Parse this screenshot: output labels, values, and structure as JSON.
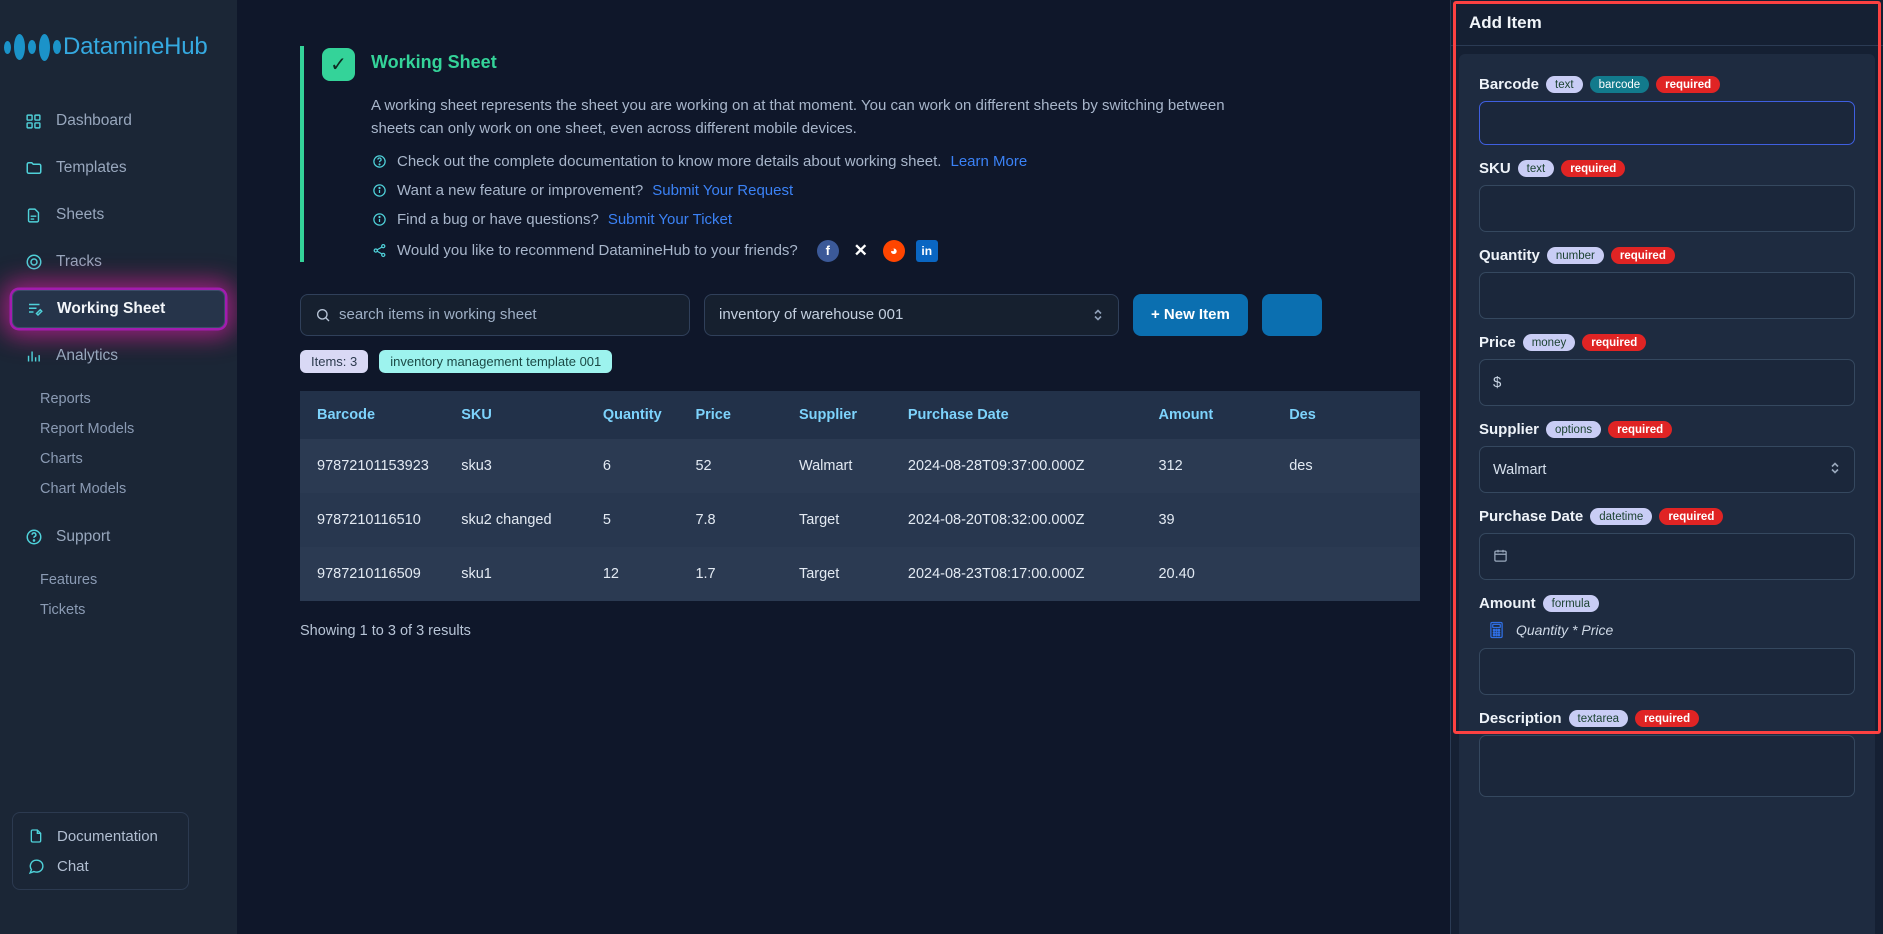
{
  "brand": {
    "name": "DatamineHub",
    "logo_icon": "bars-logo-icon"
  },
  "sidebar": {
    "items": [
      {
        "label": "Dashboard",
        "icon": "grid-icon"
      },
      {
        "label": "Templates",
        "icon": "folder-icon"
      },
      {
        "label": "Sheets",
        "icon": "document-icon"
      },
      {
        "label": "Tracks",
        "icon": "target-icon"
      },
      {
        "label": "Working Sheet",
        "icon": "sheet-edit-icon",
        "active": true
      },
      {
        "label": "Analytics",
        "icon": "bar-chart-icon"
      }
    ],
    "analytics_sub": [
      "Reports",
      "Report Models",
      "Charts",
      "Chart Models"
    ],
    "support": {
      "label": "Support",
      "icon": "question-circle-icon"
    },
    "support_sub": [
      "Features",
      "Tickets"
    ],
    "bottom": [
      {
        "label": "Documentation",
        "icon": "file-icon"
      },
      {
        "label": "Chat",
        "icon": "chat-bubble-icon"
      }
    ]
  },
  "notice": {
    "title": "Working Sheet",
    "body": "A working sheet represents the sheet you are working on at that moment. You can work on different sheets by switching between sheets can only work on one sheet, even across different mobile devices.",
    "doc_text": "Check out the complete documentation to know more details about working sheet.",
    "doc_link": "Learn More",
    "feature_text": "Want a new feature or improvement?",
    "feature_link": "Submit Your Request",
    "bug_text": "Find a bug or have questions?",
    "bug_link": "Submit Your Ticket",
    "share_text": "Would you like to recommend DatamineHub to your friends?",
    "socials": [
      "facebook-icon",
      "x-icon",
      "reddit-icon",
      "linkedin-icon"
    ]
  },
  "toolbar": {
    "search_placeholder": "search items in working sheet",
    "search_value": "",
    "sheet_selected": "inventory of warehouse 001",
    "new_item_label": "+ New Item"
  },
  "chips": {
    "items_count": "Items: 3",
    "template": "inventory management template 001"
  },
  "table": {
    "columns": [
      "Barcode",
      "SKU",
      "Quantity",
      "Price",
      "Supplier",
      "Purchase Date",
      "Amount",
      "Des"
    ],
    "rows": [
      {
        "barcode": "97872101153923",
        "sku": "sku3",
        "quantity": "6",
        "price": "52",
        "supplier": "Walmart",
        "purchase_date": "2024-08-28T09:37:00.000Z",
        "amount": "312",
        "description": "des"
      },
      {
        "barcode": "9787210116510",
        "sku": "sku2 changed",
        "quantity": "5",
        "price": "7.8",
        "supplier": "Target",
        "purchase_date": "2024-08-20T08:32:00.000Z",
        "amount": "39",
        "description": ""
      },
      {
        "barcode": "9787210116509",
        "sku": "sku1",
        "quantity": "12",
        "price": "1.7",
        "supplier": "Target",
        "purchase_date": "2024-08-23T08:17:00.000Z",
        "amount": "20.40",
        "description": ""
      }
    ],
    "results_text": "Showing 1 to 3 of 3 results"
  },
  "panel": {
    "title": "Add Item",
    "fields": {
      "barcode": {
        "name": "Barcode",
        "type_tag": "text",
        "extra_tag": "barcode",
        "required_tag": "required",
        "value": ""
      },
      "sku": {
        "name": "SKU",
        "type_tag": "text",
        "required_tag": "required",
        "value": ""
      },
      "quantity": {
        "name": "Quantity",
        "type_tag": "number",
        "required_tag": "required",
        "value": ""
      },
      "price": {
        "name": "Price",
        "type_tag": "money",
        "required_tag": "required",
        "prefix": "$",
        "value": ""
      },
      "supplier": {
        "name": "Supplier",
        "type_tag": "options",
        "required_tag": "required",
        "value": "Walmart"
      },
      "purchase_date": {
        "name": "Purchase Date",
        "type_tag": "datetime",
        "required_tag": "required",
        "value": "",
        "icon": "calendar-icon"
      },
      "amount": {
        "name": "Amount",
        "type_tag": "formula",
        "formula": "Quantity * Price",
        "icon": "calculator-icon",
        "value": ""
      },
      "description": {
        "name": "Description",
        "type_tag": "textarea",
        "required_tag": "required",
        "value": ""
      }
    }
  },
  "colors": {
    "accent": "#35a9e0",
    "success": "#34d399",
    "danger": "#e02424",
    "primary_btn": "#0b6fb0",
    "highlight": "#fc4141"
  }
}
